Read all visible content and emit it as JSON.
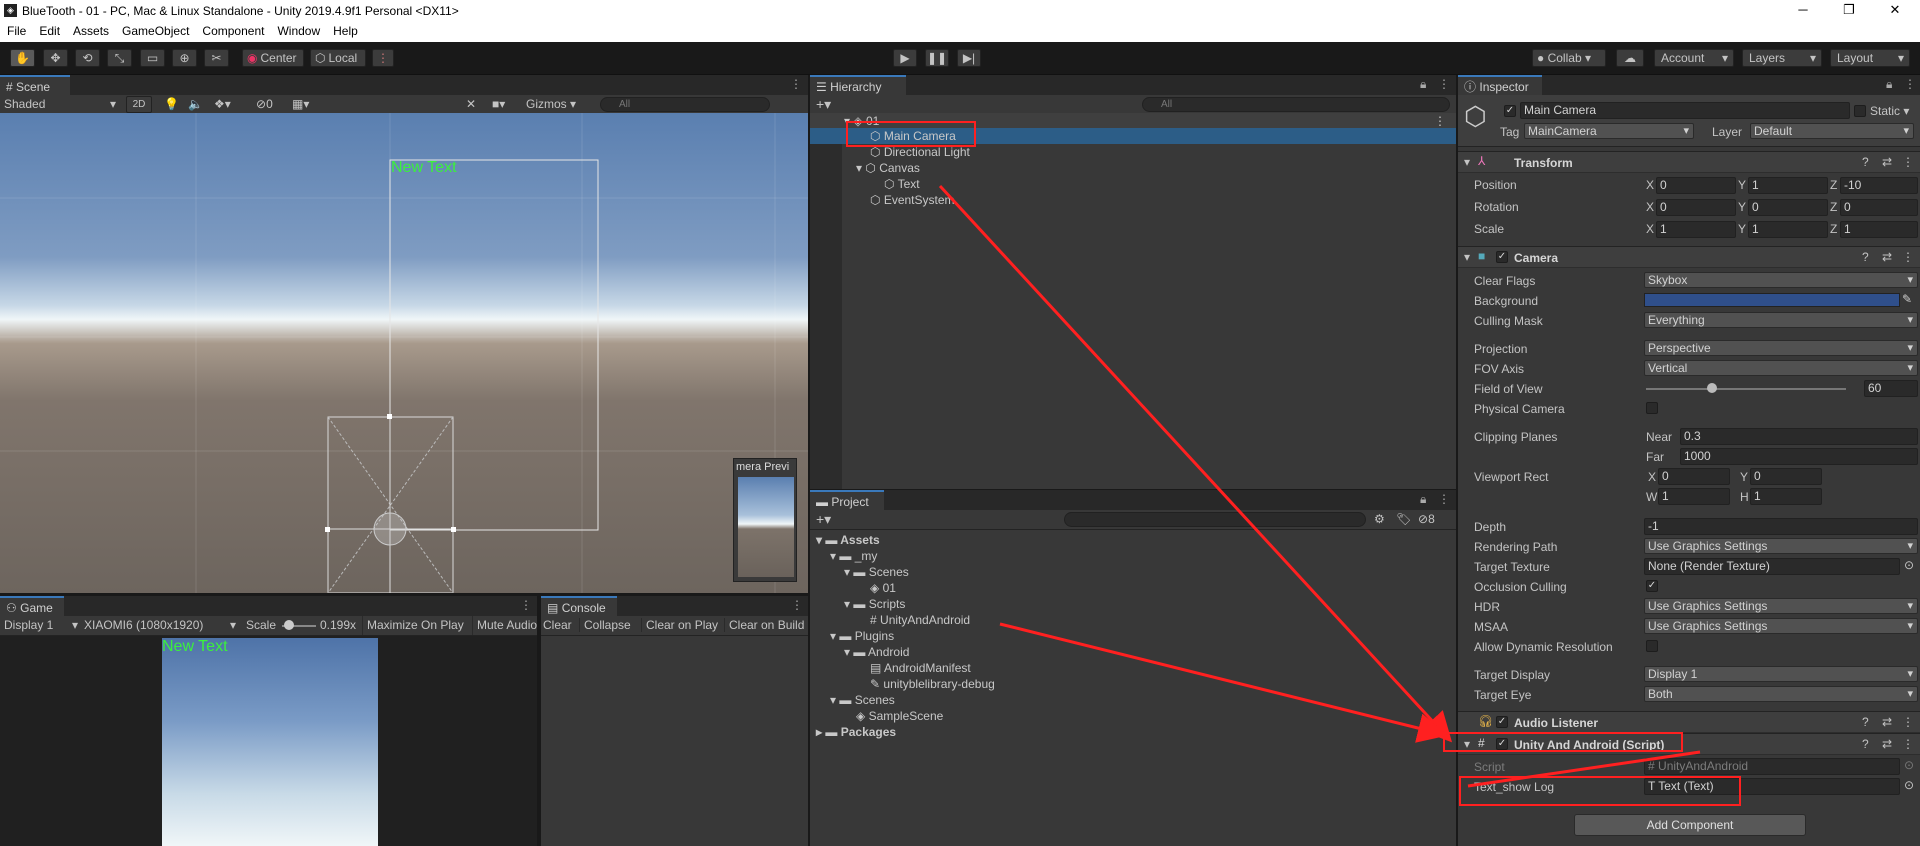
{
  "window": {
    "title": "BlueTooth - 01 - PC, Mac & Linux Standalone - Unity 2019.4.9f1 Personal <DX11>",
    "minimize": "─",
    "maximize": "❐",
    "close": "✕"
  },
  "menu": [
    "File",
    "Edit",
    "Assets",
    "GameObject",
    "Component",
    "Window",
    "Help"
  ],
  "toolbar": {
    "center": "Center",
    "local": "Local",
    "collab": "Collab",
    "account": "Account",
    "layers": "Layers",
    "layout": "Layout"
  },
  "scene": {
    "tab": "Scene",
    "shading": "Shaded",
    "mode2d": "2D",
    "hidden_count": "0",
    "gizmos": "Gizmos",
    "search_placeholder": "All",
    "canvas_text": "New Text",
    "camera_preview": "mera Previ"
  },
  "game": {
    "tab": "Game",
    "display": "Display 1",
    "resolution": "XIAOMI6 (1080x1920)",
    "scale_label": "Scale",
    "scale_value": "0.199x",
    "maximize": "Maximize On Play",
    "mute": "Mute Audio",
    "canvas_text": "New Text"
  },
  "console": {
    "tab": "Console",
    "clear": "Clear",
    "collapse": "Collapse",
    "clear_on_play": "Clear on Play",
    "clear_on_build": "Clear on Build"
  },
  "hierarchy": {
    "tab": "Hierarchy",
    "search_placeholder": "All",
    "scene_name": "01",
    "items": [
      {
        "label": "Main Camera",
        "depth": 1,
        "selected": true
      },
      {
        "label": "Directional Light",
        "depth": 1
      },
      {
        "label": "Canvas",
        "depth": 1,
        "expanded": true
      },
      {
        "label": "Text",
        "depth": 2
      },
      {
        "label": "EventSystem",
        "depth": 1
      }
    ]
  },
  "project": {
    "tab": "Project",
    "hidden_count": "8",
    "tree": [
      {
        "label": "Assets",
        "depth": 0,
        "kind": "folder",
        "bold": true
      },
      {
        "label": "_my",
        "depth": 1,
        "kind": "folder"
      },
      {
        "label": "Scenes",
        "depth": 2,
        "kind": "folder"
      },
      {
        "label": "01",
        "depth": 3,
        "kind": "unity"
      },
      {
        "label": "Scripts",
        "depth": 2,
        "kind": "folder"
      },
      {
        "label": "UnityAndAndroid",
        "depth": 3,
        "kind": "script"
      },
      {
        "label": "Plugins",
        "depth": 1,
        "kind": "folder"
      },
      {
        "label": "Android",
        "depth": 2,
        "kind": "folder"
      },
      {
        "label": "AndroidManifest",
        "depth": 3,
        "kind": "file"
      },
      {
        "label": "unityblelibrary-debug",
        "depth": 3,
        "kind": "file"
      },
      {
        "label": "Scenes",
        "depth": 1,
        "kind": "folder"
      },
      {
        "label": "SampleScene",
        "depth": 2,
        "kind": "unity"
      },
      {
        "label": "Packages",
        "depth": 0,
        "kind": "folder",
        "bold": true
      }
    ]
  },
  "inspector": {
    "tab": "Inspector",
    "object_name": "Main Camera",
    "static": "Static",
    "tag_label": "Tag",
    "tag": "MainCamera",
    "layer_label": "Layer",
    "layer": "Default",
    "transform": {
      "title": "Transform",
      "rows": [
        {
          "label": "Position",
          "x": "0",
          "y": "1",
          "z": "-10"
        },
        {
          "label": "Rotation",
          "x": "0",
          "y": "0",
          "z": "0"
        },
        {
          "label": "Scale",
          "x": "1",
          "y": "1",
          "z": "1"
        }
      ]
    },
    "camera": {
      "title": "Camera",
      "clear_flags_label": "Clear Flags",
      "clear_flags": "Skybox",
      "background_label": "Background",
      "background_color": "#2f4f8b",
      "culling_mask_label": "Culling Mask",
      "culling_mask": "Everything",
      "projection_label": "Projection",
      "projection": "Perspective",
      "fov_axis_label": "FOV Axis",
      "fov_axis": "Vertical",
      "fov_label": "Field of View",
      "fov": "60",
      "fov_slider_fraction": 0.33,
      "physical_label": "Physical Camera",
      "clipping_label": "Clipping Planes",
      "near_label": "Near",
      "near": "0.3",
      "far_label": "Far",
      "far": "1000",
      "viewport_label": "Viewport Rect",
      "vx": "0",
      "vy": "0",
      "vw": "1",
      "vh": "1",
      "depth_label": "Depth",
      "depth": "-1",
      "rendering_path_label": "Rendering Path",
      "rendering_path": "Use Graphics Settings",
      "target_texture_label": "Target Texture",
      "target_texture": "None (Render Texture)",
      "occlusion_label": "Occlusion Culling",
      "hdr_label": "HDR",
      "hdr": "Use Graphics Settings",
      "msaa_label": "MSAA",
      "msaa": "Use Graphics Settings",
      "dynres_label": "Allow Dynamic Resolution",
      "target_display_label": "Target Display",
      "target_display": "Display 1",
      "target_eye_label": "Target Eye",
      "target_eye": "Both"
    },
    "audio_listener": {
      "title": "Audio Listener"
    },
    "script_component": {
      "title": "Unity And Android (Script)",
      "script_label": "Script",
      "script": "UnityAndAndroid",
      "field_label": "Text_show Log",
      "field_value": "Text (Text)"
    },
    "add_component": "Add Component"
  },
  "colors": {
    "accent_tab": "#3a79bb",
    "selection": "#2c5d87",
    "annotation_red": "#ff2020",
    "canvas_text_green": "#3cf03c"
  }
}
